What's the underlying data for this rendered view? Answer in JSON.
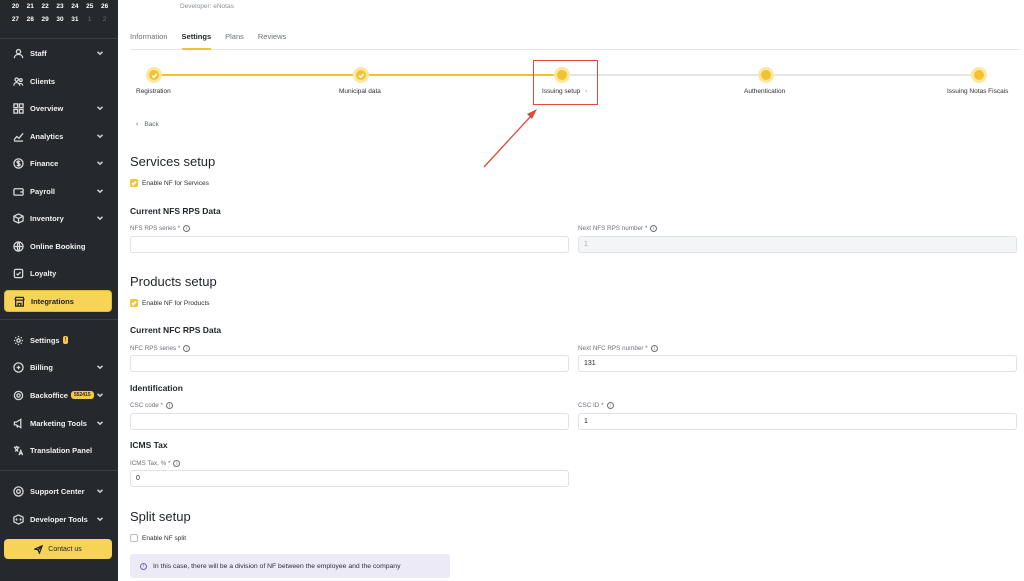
{
  "calendar": {
    "rows": [
      [
        "20",
        "21",
        "22",
        "23",
        "24",
        "25",
        "26"
      ],
      [
        "27",
        "28",
        "29",
        "30",
        "31",
        "1",
        "2"
      ]
    ]
  },
  "sidebar": {
    "items": [
      {
        "label": "Staff",
        "icon": "user-icon",
        "chevron": true
      },
      {
        "label": "Clients",
        "icon": "users-icon",
        "chevron": false
      },
      {
        "label": "Overview",
        "icon": "grid-icon",
        "chevron": true
      },
      {
        "label": "Analytics",
        "icon": "chart-icon",
        "chevron": true
      },
      {
        "label": "Finance",
        "icon": "dollar-icon",
        "chevron": true
      },
      {
        "label": "Payroll",
        "icon": "wallet-icon",
        "chevron": true
      },
      {
        "label": "Inventory",
        "icon": "box-icon",
        "chevron": true
      },
      {
        "label": "Online Booking",
        "icon": "globe-icon",
        "chevron": false
      },
      {
        "label": "Loyalty",
        "icon": "loyalty-icon",
        "chevron": false
      },
      {
        "label": "Integrations",
        "icon": "store-icon",
        "chevron": false,
        "active": true
      },
      {
        "label": "Settings",
        "icon": "gear-icon",
        "chevron": false,
        "badge": "!"
      },
      {
        "label": "Billing",
        "icon": "billing-icon",
        "chevron": true
      },
      {
        "label": "Backoffice",
        "icon": "backoffice-icon",
        "chevron": true,
        "tag": "552415"
      },
      {
        "label": "Marketing Tools",
        "icon": "megaphone-icon",
        "chevron": true
      },
      {
        "label": "Translation Panel",
        "icon": "translate-icon",
        "chevron": false
      },
      {
        "label": "Support Center",
        "icon": "support-icon",
        "chevron": true
      },
      {
        "label": "Developer Tools",
        "icon": "code-icon",
        "chevron": true
      }
    ],
    "contact_label": "Contact us"
  },
  "header": {
    "developer": "Developer: eNotas"
  },
  "tabs": [
    {
      "label": "Information",
      "active": false
    },
    {
      "label": "Settings",
      "active": true
    },
    {
      "label": "Plans",
      "active": false
    },
    {
      "label": "Reviews",
      "active": false
    }
  ],
  "stepper": [
    {
      "label": "Registration",
      "done": true
    },
    {
      "label": "Municipal data",
      "done": true
    },
    {
      "label": "Issuing setup",
      "current": true,
      "suffix": "›"
    },
    {
      "label": "Authentication",
      "done": false
    },
    {
      "label": "Issuing Notas Fiscais",
      "done": false
    }
  ],
  "back_label": "Back",
  "services": {
    "title": "Services setup",
    "enable_label": "Enable NF for Services",
    "enabled": true,
    "subtitle": "Current NFS RPS Data",
    "series_label": "NFS RPS series *",
    "series_value": "",
    "next_label": "Next NFS RPS number *",
    "next_value": "1"
  },
  "products": {
    "title": "Products setup",
    "enable_label": "Enable NF for Products",
    "enabled": true,
    "subtitle": "Current NFC RPS Data",
    "series_label": "NFC RPS series *",
    "series_value": "",
    "next_label": "Next NFC RPS number *",
    "next_value": "131"
  },
  "identification": {
    "title": "Identification",
    "csc_code_label": "CSC code *",
    "csc_code_value": "",
    "csc_id_label": "CSC ID *",
    "csc_id_value": "1"
  },
  "icms": {
    "title": "ICMS Tax",
    "label": "ICMS Tax, % *",
    "value": "0"
  },
  "split": {
    "title": "Split setup",
    "enable_label": "Enable NF split",
    "enabled": false,
    "note": "In this case, there will be a division of NF between the employee and the company"
  },
  "colors": {
    "sidebar_bg": "#25282c",
    "accent": "#f2c330",
    "highlight": "#e0493b"
  }
}
